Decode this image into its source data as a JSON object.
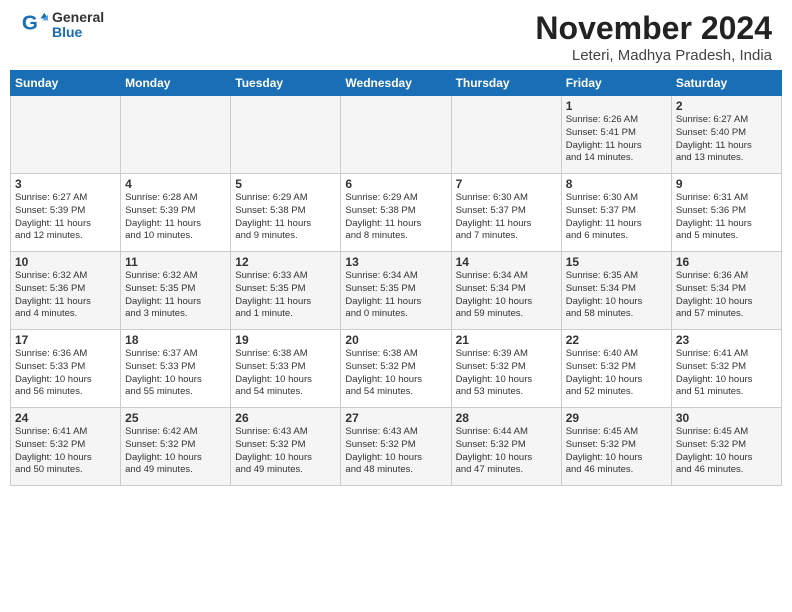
{
  "header": {
    "logo_general": "General",
    "logo_blue": "Blue",
    "month_title": "November 2024",
    "location": "Leteri, Madhya Pradesh, India"
  },
  "days_of_week": [
    "Sunday",
    "Monday",
    "Tuesday",
    "Wednesday",
    "Thursday",
    "Friday",
    "Saturday"
  ],
  "weeks": [
    [
      {
        "day": "",
        "info": ""
      },
      {
        "day": "",
        "info": ""
      },
      {
        "day": "",
        "info": ""
      },
      {
        "day": "",
        "info": ""
      },
      {
        "day": "",
        "info": ""
      },
      {
        "day": "1",
        "info": "Sunrise: 6:26 AM\nSunset: 5:41 PM\nDaylight: 11 hours\nand 14 minutes."
      },
      {
        "day": "2",
        "info": "Sunrise: 6:27 AM\nSunset: 5:40 PM\nDaylight: 11 hours\nand 13 minutes."
      }
    ],
    [
      {
        "day": "3",
        "info": "Sunrise: 6:27 AM\nSunset: 5:39 PM\nDaylight: 11 hours\nand 12 minutes."
      },
      {
        "day": "4",
        "info": "Sunrise: 6:28 AM\nSunset: 5:39 PM\nDaylight: 11 hours\nand 10 minutes."
      },
      {
        "day": "5",
        "info": "Sunrise: 6:29 AM\nSunset: 5:38 PM\nDaylight: 11 hours\nand 9 minutes."
      },
      {
        "day": "6",
        "info": "Sunrise: 6:29 AM\nSunset: 5:38 PM\nDaylight: 11 hours\nand 8 minutes."
      },
      {
        "day": "7",
        "info": "Sunrise: 6:30 AM\nSunset: 5:37 PM\nDaylight: 11 hours\nand 7 minutes."
      },
      {
        "day": "8",
        "info": "Sunrise: 6:30 AM\nSunset: 5:37 PM\nDaylight: 11 hours\nand 6 minutes."
      },
      {
        "day": "9",
        "info": "Sunrise: 6:31 AM\nSunset: 5:36 PM\nDaylight: 11 hours\nand 5 minutes."
      }
    ],
    [
      {
        "day": "10",
        "info": "Sunrise: 6:32 AM\nSunset: 5:36 PM\nDaylight: 11 hours\nand 4 minutes."
      },
      {
        "day": "11",
        "info": "Sunrise: 6:32 AM\nSunset: 5:35 PM\nDaylight: 11 hours\nand 3 minutes."
      },
      {
        "day": "12",
        "info": "Sunrise: 6:33 AM\nSunset: 5:35 PM\nDaylight: 11 hours\nand 1 minute."
      },
      {
        "day": "13",
        "info": "Sunrise: 6:34 AM\nSunset: 5:35 PM\nDaylight: 11 hours\nand 0 minutes."
      },
      {
        "day": "14",
        "info": "Sunrise: 6:34 AM\nSunset: 5:34 PM\nDaylight: 10 hours\nand 59 minutes."
      },
      {
        "day": "15",
        "info": "Sunrise: 6:35 AM\nSunset: 5:34 PM\nDaylight: 10 hours\nand 58 minutes."
      },
      {
        "day": "16",
        "info": "Sunrise: 6:36 AM\nSunset: 5:34 PM\nDaylight: 10 hours\nand 57 minutes."
      }
    ],
    [
      {
        "day": "17",
        "info": "Sunrise: 6:36 AM\nSunset: 5:33 PM\nDaylight: 10 hours\nand 56 minutes."
      },
      {
        "day": "18",
        "info": "Sunrise: 6:37 AM\nSunset: 5:33 PM\nDaylight: 10 hours\nand 55 minutes."
      },
      {
        "day": "19",
        "info": "Sunrise: 6:38 AM\nSunset: 5:33 PM\nDaylight: 10 hours\nand 54 minutes."
      },
      {
        "day": "20",
        "info": "Sunrise: 6:38 AM\nSunset: 5:32 PM\nDaylight: 10 hours\nand 54 minutes."
      },
      {
        "day": "21",
        "info": "Sunrise: 6:39 AM\nSunset: 5:32 PM\nDaylight: 10 hours\nand 53 minutes."
      },
      {
        "day": "22",
        "info": "Sunrise: 6:40 AM\nSunset: 5:32 PM\nDaylight: 10 hours\nand 52 minutes."
      },
      {
        "day": "23",
        "info": "Sunrise: 6:41 AM\nSunset: 5:32 PM\nDaylight: 10 hours\nand 51 minutes."
      }
    ],
    [
      {
        "day": "24",
        "info": "Sunrise: 6:41 AM\nSunset: 5:32 PM\nDaylight: 10 hours\nand 50 minutes."
      },
      {
        "day": "25",
        "info": "Sunrise: 6:42 AM\nSunset: 5:32 PM\nDaylight: 10 hours\nand 49 minutes."
      },
      {
        "day": "26",
        "info": "Sunrise: 6:43 AM\nSunset: 5:32 PM\nDaylight: 10 hours\nand 49 minutes."
      },
      {
        "day": "27",
        "info": "Sunrise: 6:43 AM\nSunset: 5:32 PM\nDaylight: 10 hours\nand 48 minutes."
      },
      {
        "day": "28",
        "info": "Sunrise: 6:44 AM\nSunset: 5:32 PM\nDaylight: 10 hours\nand 47 minutes."
      },
      {
        "day": "29",
        "info": "Sunrise: 6:45 AM\nSunset: 5:32 PM\nDaylight: 10 hours\nand 46 minutes."
      },
      {
        "day": "30",
        "info": "Sunrise: 6:45 AM\nSunset: 5:32 PM\nDaylight: 10 hours\nand 46 minutes."
      }
    ]
  ]
}
